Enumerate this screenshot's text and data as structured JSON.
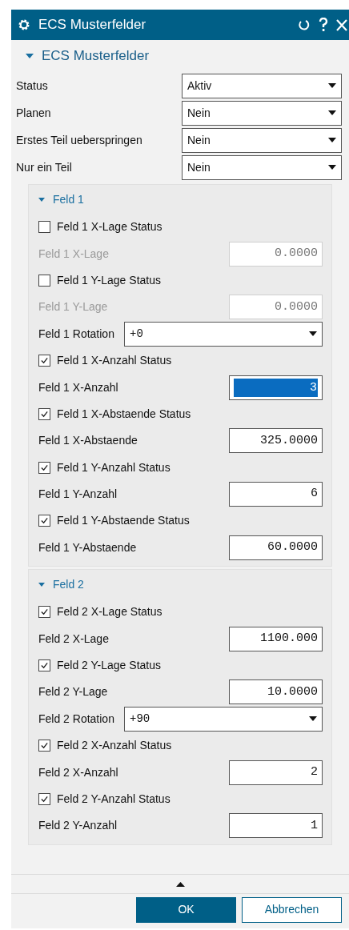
{
  "window": {
    "title": "ECS Musterfelder"
  },
  "section": {
    "title": "ECS Musterfelder",
    "expanded": true
  },
  "settings": [
    {
      "label": "Status",
      "value": "Aktiv"
    },
    {
      "label": "Planen",
      "value": "Nein"
    },
    {
      "label": "Erstes Teil ueberspringen",
      "value": "Nein"
    },
    {
      "label": "Nur ein Teil",
      "value": "Nein"
    }
  ],
  "groups": [
    {
      "title": "Feld 1",
      "expanded": true,
      "rows": [
        {
          "kind": "checkbox",
          "label": "Feld 1 X-Lage Status",
          "checked": false
        },
        {
          "kind": "number",
          "label": "Feld 1 X-Lage",
          "value": "0.0000",
          "disabled": true,
          "text_selected": false
        },
        {
          "kind": "checkbox",
          "label": "Feld 1 Y-Lage Status",
          "checked": false
        },
        {
          "kind": "number",
          "label": "Feld 1 Y-Lage",
          "value": "0.0000",
          "disabled": true,
          "text_selected": false
        },
        {
          "kind": "dropdown",
          "label": "Feld 1 Rotation",
          "value": "+0"
        },
        {
          "kind": "checkbox",
          "label": "Feld 1 X-Anzahl Status",
          "checked": true
        },
        {
          "kind": "number",
          "label": "Feld 1 X-Anzahl",
          "value": "3",
          "disabled": false,
          "text_selected": true
        },
        {
          "kind": "checkbox",
          "label": "Feld 1 X-Abstaende Status",
          "checked": true
        },
        {
          "kind": "number",
          "label": "Feld 1 X-Abstaende",
          "value": "325.0000",
          "disabled": false,
          "text_selected": false
        },
        {
          "kind": "checkbox",
          "label": "Feld 1 Y-Anzahl Status",
          "checked": true
        },
        {
          "kind": "number",
          "label": "Feld 1 Y-Anzahl",
          "value": "6",
          "disabled": false,
          "text_selected": false
        },
        {
          "kind": "checkbox",
          "label": "Feld 1 Y-Abstaende Status",
          "checked": true
        },
        {
          "kind": "number",
          "label": "Feld 1 Y-Abstaende",
          "value": "60.0000",
          "disabled": false,
          "text_selected": false
        }
      ]
    },
    {
      "title": "Feld 2",
      "expanded": true,
      "rows": [
        {
          "kind": "checkbox",
          "label": "Feld 2 X-Lage Status",
          "checked": true
        },
        {
          "kind": "number",
          "label": "Feld 2 X-Lage",
          "value": "1100.000",
          "disabled": false,
          "text_selected": false
        },
        {
          "kind": "checkbox",
          "label": "Feld 2 Y-Lage Status",
          "checked": true
        },
        {
          "kind": "number",
          "label": "Feld 2 Y-Lage",
          "value": "10.0000",
          "disabled": false,
          "text_selected": false
        },
        {
          "kind": "dropdown",
          "label": "Feld 2 Rotation",
          "value": "+90"
        },
        {
          "kind": "checkbox",
          "label": "Feld 2 X-Anzahl Status",
          "checked": true
        },
        {
          "kind": "number",
          "label": "Feld 2 X-Anzahl",
          "value": "2",
          "disabled": false,
          "text_selected": false
        },
        {
          "kind": "checkbox",
          "label": "Feld 2 Y-Anzahl Status",
          "checked": true
        },
        {
          "kind": "number",
          "label": "Feld 2 Y-Anzahl",
          "value": "1",
          "disabled": false,
          "text_selected": false
        }
      ]
    }
  ],
  "buttons": [
    {
      "label": "OK",
      "primary": true
    },
    {
      "label": "Abbrechen",
      "primary": false
    }
  ]
}
